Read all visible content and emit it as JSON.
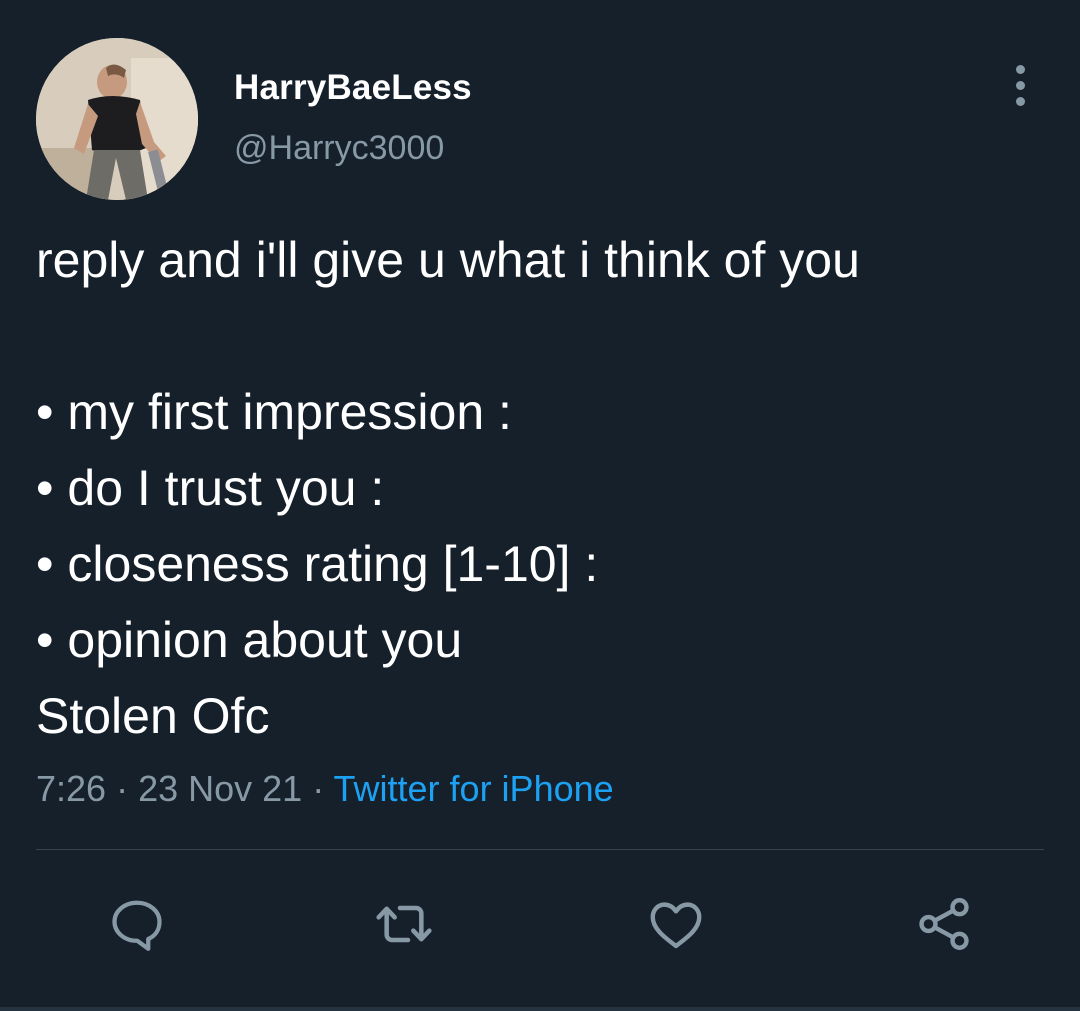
{
  "user": {
    "display_name": "HarryBaeLess",
    "handle": "@Harryc3000"
  },
  "tweet": {
    "lines": [
      "reply and i'll give u what i think of you",
      "",
      "• my first impression :",
      "• do I trust you :",
      "• closeness rating [1-10] :",
      "• opinion about you",
      "Stolen Ofc"
    ]
  },
  "meta": {
    "time": "7:26",
    "separator": " · ",
    "date": "23 Nov 21",
    "source": "Twitter for iPhone"
  },
  "icons": {
    "more": "more-vertical-icon",
    "reply": "reply-icon",
    "retweet": "retweet-icon",
    "like": "heart-icon",
    "share": "share-icon"
  },
  "colors": {
    "background": "#15202b",
    "text": "#ffffff",
    "secondary": "#8899a6",
    "link": "#1da1f2",
    "divider": "#38444d"
  }
}
